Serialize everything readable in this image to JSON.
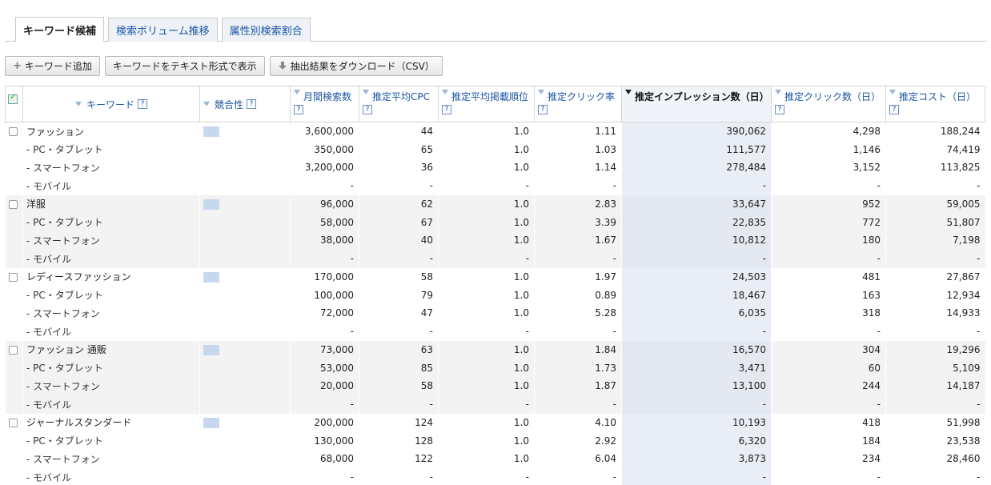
{
  "tabs": [
    {
      "label": "キーワード候補",
      "active": true
    },
    {
      "label": "検索ボリューム推移",
      "active": false
    },
    {
      "label": "属性別検索割合",
      "active": false
    }
  ],
  "toolbar": {
    "add_keyword": "キーワード追加",
    "show_text": "キーワードをテキスト形式で表示",
    "download": "抽出結果をダウンロード（CSV）"
  },
  "columns": {
    "keyword": "キーワード",
    "competition": "競合性",
    "monthly_searches": "月間検索数",
    "avg_cpc": "推定平均CPC",
    "avg_position": "推定平均掲載順位",
    "ctr": "推定クリック率",
    "impressions": "推定インプレッション数（日）",
    "clicks": "推定クリック数（日）",
    "cost": "推定コスト（日）",
    "help": "?"
  },
  "rows": [
    {
      "keyword": "ファッション",
      "sub": false,
      "monthly": "3,600,000",
      "cpc": "44",
      "pos": "1.0",
      "ctr": "1.11",
      "imp": "390,062",
      "clicks": "4,298",
      "cost": "188,244"
    },
    {
      "keyword": "- PC・タブレット",
      "sub": true,
      "monthly": "350,000",
      "cpc": "65",
      "pos": "1.0",
      "ctr": "1.03",
      "imp": "111,577",
      "clicks": "1,146",
      "cost": "74,419"
    },
    {
      "keyword": "- スマートフォン",
      "sub": true,
      "monthly": "3,200,000",
      "cpc": "36",
      "pos": "1.0",
      "ctr": "1.14",
      "imp": "278,484",
      "clicks": "3,152",
      "cost": "113,825"
    },
    {
      "keyword": "- モバイル",
      "sub": true,
      "monthly": "-",
      "cpc": "-",
      "pos": "-",
      "ctr": "-",
      "imp": "-",
      "clicks": "-",
      "cost": "-"
    },
    {
      "keyword": "洋服",
      "sub": false,
      "monthly": "96,000",
      "cpc": "62",
      "pos": "1.0",
      "ctr": "2.83",
      "imp": "33,647",
      "clicks": "952",
      "cost": "59,005"
    },
    {
      "keyword": "- PC・タブレット",
      "sub": true,
      "monthly": "58,000",
      "cpc": "67",
      "pos": "1.0",
      "ctr": "3.39",
      "imp": "22,835",
      "clicks": "772",
      "cost": "51,807"
    },
    {
      "keyword": "- スマートフォン",
      "sub": true,
      "monthly": "38,000",
      "cpc": "40",
      "pos": "1.0",
      "ctr": "1.67",
      "imp": "10,812",
      "clicks": "180",
      "cost": "7,198"
    },
    {
      "keyword": "- モバイル",
      "sub": true,
      "monthly": "-",
      "cpc": "-",
      "pos": "-",
      "ctr": "-",
      "imp": "-",
      "clicks": "-",
      "cost": "-"
    },
    {
      "keyword": "レディースファッション",
      "sub": false,
      "monthly": "170,000",
      "cpc": "58",
      "pos": "1.0",
      "ctr": "1.97",
      "imp": "24,503",
      "clicks": "481",
      "cost": "27,867"
    },
    {
      "keyword": "- PC・タブレット",
      "sub": true,
      "monthly": "100,000",
      "cpc": "79",
      "pos": "1.0",
      "ctr": "0.89",
      "imp": "18,467",
      "clicks": "163",
      "cost": "12,934"
    },
    {
      "keyword": "- スマートフォン",
      "sub": true,
      "monthly": "72,000",
      "cpc": "47",
      "pos": "1.0",
      "ctr": "5.28",
      "imp": "6,035",
      "clicks": "318",
      "cost": "14,933"
    },
    {
      "keyword": "- モバイル",
      "sub": true,
      "monthly": "-",
      "cpc": "-",
      "pos": "-",
      "ctr": "-",
      "imp": "-",
      "clicks": "-",
      "cost": "-"
    },
    {
      "keyword": "ファッション 通販",
      "sub": false,
      "monthly": "73,000",
      "cpc": "63",
      "pos": "1.0",
      "ctr": "1.84",
      "imp": "16,570",
      "clicks": "304",
      "cost": "19,296"
    },
    {
      "keyword": "- PC・タブレット",
      "sub": true,
      "monthly": "53,000",
      "cpc": "85",
      "pos": "1.0",
      "ctr": "1.73",
      "imp": "3,471",
      "clicks": "60",
      "cost": "5,109"
    },
    {
      "keyword": "- スマートフォン",
      "sub": true,
      "monthly": "20,000",
      "cpc": "58",
      "pos": "1.0",
      "ctr": "1.87",
      "imp": "13,100",
      "clicks": "244",
      "cost": "14,187"
    },
    {
      "keyword": "- モバイル",
      "sub": true,
      "monthly": "-",
      "cpc": "-",
      "pos": "-",
      "ctr": "-",
      "imp": "-",
      "clicks": "-",
      "cost": "-"
    },
    {
      "keyword": "ジャーナルスタンダード",
      "sub": false,
      "monthly": "200,000",
      "cpc": "124",
      "pos": "1.0",
      "ctr": "4.10",
      "imp": "10,193",
      "clicks": "418",
      "cost": "51,998"
    },
    {
      "keyword": "- PC・タブレット",
      "sub": true,
      "monthly": "130,000",
      "cpc": "128",
      "pos": "1.0",
      "ctr": "2.92",
      "imp": "6,320",
      "clicks": "184",
      "cost": "23,538"
    },
    {
      "keyword": "- スマートフォン",
      "sub": true,
      "monthly": "68,000",
      "cpc": "122",
      "pos": "1.0",
      "ctr": "6.04",
      "imp": "3,873",
      "clicks": "234",
      "cost": "28,460"
    },
    {
      "keyword": "- モバイル",
      "sub": true,
      "monthly": "-",
      "cpc": "-",
      "pos": "-",
      "ctr": "-",
      "imp": "-",
      "clicks": "-",
      "cost": "-"
    }
  ],
  "colors": {
    "link": "#1a55a3",
    "highlight_column": "#e8edf6",
    "competition_bar": "#c7d8ee"
  }
}
